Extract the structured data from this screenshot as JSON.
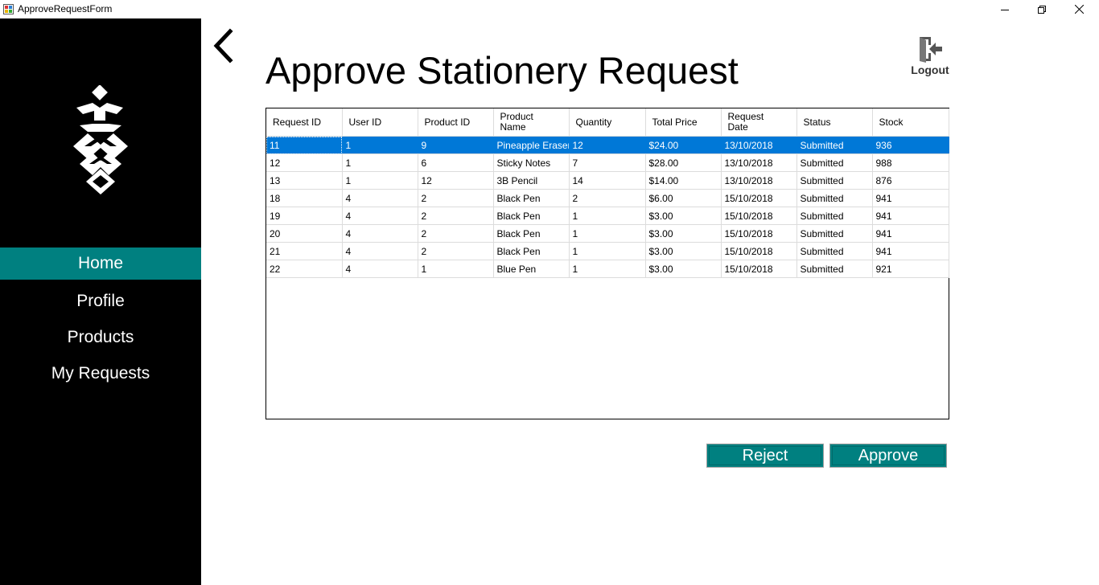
{
  "window": {
    "title": "ApproveRequestForm",
    "icon": "app-form-icon"
  },
  "sidebar": {
    "logo": "stacked-diamond-logo",
    "items": [
      {
        "label": "Home",
        "active": true
      },
      {
        "label": "Profile",
        "active": false
      },
      {
        "label": "Products",
        "active": false
      },
      {
        "label": "My Requests",
        "active": false
      }
    ]
  },
  "header": {
    "title": "Approve Stationery Request",
    "back_icon": "chevron-left-icon",
    "logout_label": "Logout",
    "logout_icon": "logout-door-icon"
  },
  "grid": {
    "columns": [
      "Request ID",
      "User ID",
      "Product ID",
      "Product\nName",
      "Quantity",
      "Total Price",
      "Request\nDate",
      "Status",
      "Stock"
    ],
    "rows": [
      [
        "11",
        "1",
        "9",
        "Pineapple Eraser",
        "12",
        "$24.00",
        "13/10/2018",
        "Submitted",
        "936"
      ],
      [
        "12",
        "1",
        "6",
        "Sticky Notes",
        "7",
        "$28.00",
        "13/10/2018",
        "Submitted",
        "988"
      ],
      [
        "13",
        "1",
        "12",
        "3B Pencil",
        "14",
        "$14.00",
        "13/10/2018",
        "Submitted",
        "876"
      ],
      [
        "18",
        "4",
        "2",
        "Black Pen",
        "2",
        "$6.00",
        "15/10/2018",
        "Submitted",
        "941"
      ],
      [
        "19",
        "4",
        "2",
        "Black Pen",
        "1",
        "$3.00",
        "15/10/2018",
        "Submitted",
        "941"
      ],
      [
        "20",
        "4",
        "2",
        "Black Pen",
        "1",
        "$3.00",
        "15/10/2018",
        "Submitted",
        "941"
      ],
      [
        "21",
        "4",
        "2",
        "Black Pen",
        "1",
        "$3.00",
        "15/10/2018",
        "Submitted",
        "941"
      ],
      [
        "22",
        "4",
        "1",
        "Blue Pen",
        "1",
        "$3.00",
        "15/10/2018",
        "Submitted",
        "921"
      ]
    ],
    "selected_row": 0
  },
  "actions": {
    "reject_label": "Reject",
    "approve_label": "Approve"
  },
  "colors": {
    "accent": "#008080",
    "sidebar_bg": "#000000",
    "selection": "#0078d7"
  }
}
